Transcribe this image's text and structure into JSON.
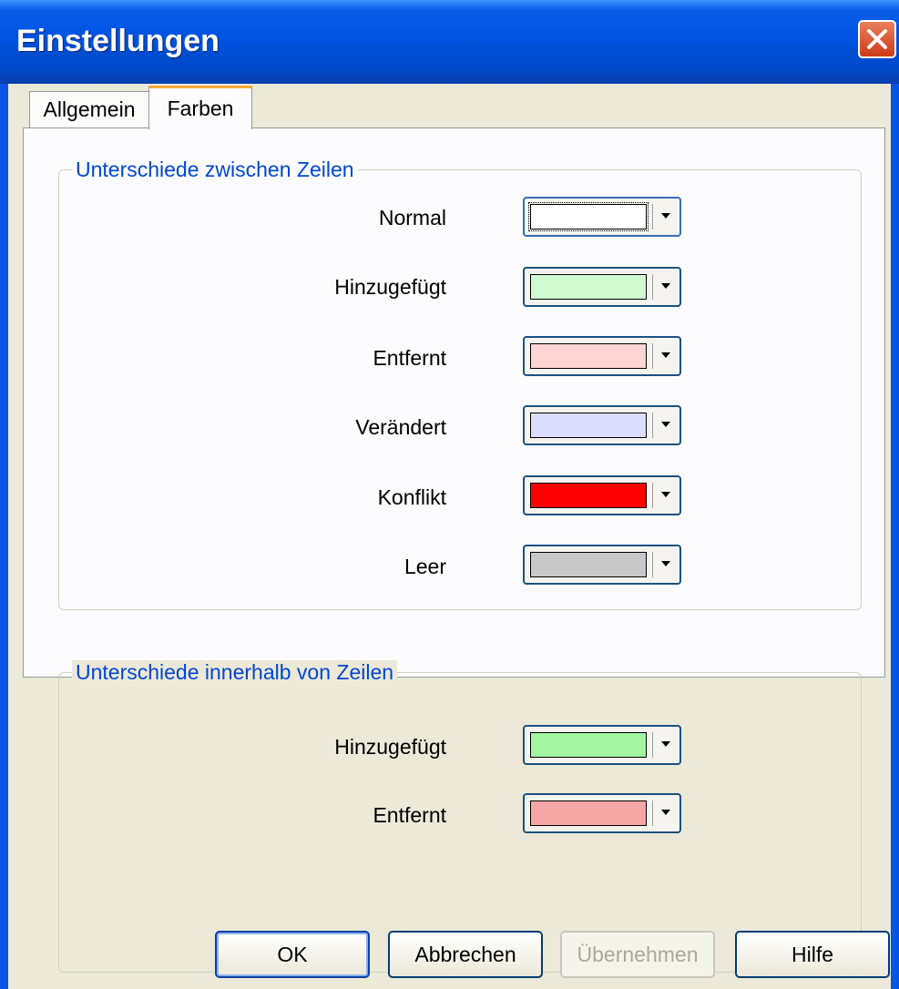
{
  "window": {
    "title": "Einstellungen"
  },
  "tabs": [
    {
      "label": "Allgemein",
      "active": false
    },
    {
      "label": "Farben",
      "active": true
    }
  ],
  "groups": {
    "lines": {
      "title": "Unterschiede zwischen Zeilen",
      "rows": [
        {
          "label": "Normal",
          "color": "#ffffff"
        },
        {
          "label": "Hinzugefügt",
          "color": "#d1fad3"
        },
        {
          "label": "Entfernt",
          "color": "#ffd4d4"
        },
        {
          "label": "Verändert",
          "color": "#dcdcfc"
        },
        {
          "label": "Konflikt",
          "color": "#ff0000"
        },
        {
          "label": "Leer",
          "color": "#c8c8c8"
        }
      ]
    },
    "inline": {
      "title": "Unterschiede innerhalb von Zeilen",
      "rows": [
        {
          "label": "Hinzugefügt",
          "color": "#a3f5a3"
        },
        {
          "label": "Entfernt",
          "color": "#f5a7a7"
        }
      ]
    }
  },
  "buttons": {
    "ok": "OK",
    "cancel": "Abbrechen",
    "apply": "Übernehmen",
    "help": "Hilfe"
  }
}
